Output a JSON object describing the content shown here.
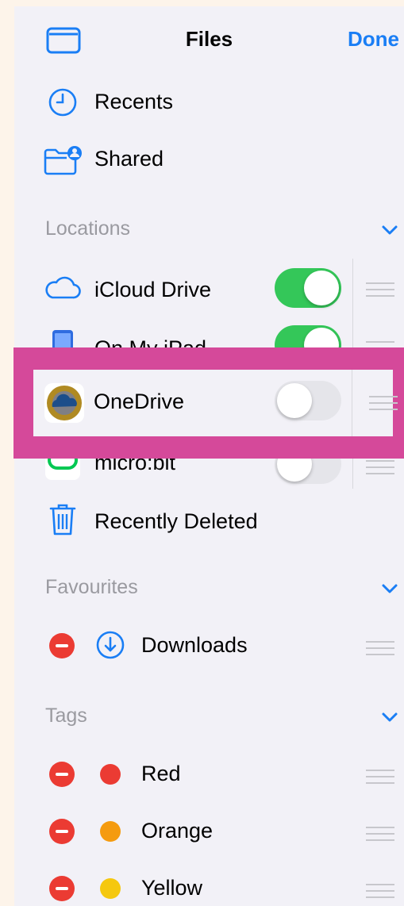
{
  "header": {
    "title": "Files",
    "done_label": "Done"
  },
  "top_items": [
    {
      "label": "Recents",
      "icon": "clock-icon"
    },
    {
      "label": "Shared",
      "icon": "shared-folder-icon"
    }
  ],
  "locations": {
    "header": "Locations",
    "items": [
      {
        "label": "iCloud Drive",
        "enabled": true,
        "icon": "cloud-icon"
      },
      {
        "label": "On My iPad",
        "enabled": true,
        "icon": "ipad-icon"
      },
      {
        "label": "OneDrive",
        "enabled": false,
        "icon": "onedrive-icon"
      },
      {
        "label": "micro:bit",
        "enabled": false,
        "icon": "microbit-icon"
      }
    ],
    "recently_deleted": "Recently Deleted"
  },
  "favourites": {
    "header": "Favourites",
    "items": [
      {
        "label": "Downloads",
        "icon": "download-icon"
      }
    ]
  },
  "tags": {
    "header": "Tags",
    "items": [
      {
        "label": "Red",
        "color": "#eb3b33"
      },
      {
        "label": "Orange",
        "color": "#f59b0f"
      },
      {
        "label": "Yellow",
        "color": "#f5c80f"
      }
    ]
  },
  "colors": {
    "accent": "#1a7ef5",
    "toggle_on": "#34c759",
    "highlight": "#d5499a"
  }
}
